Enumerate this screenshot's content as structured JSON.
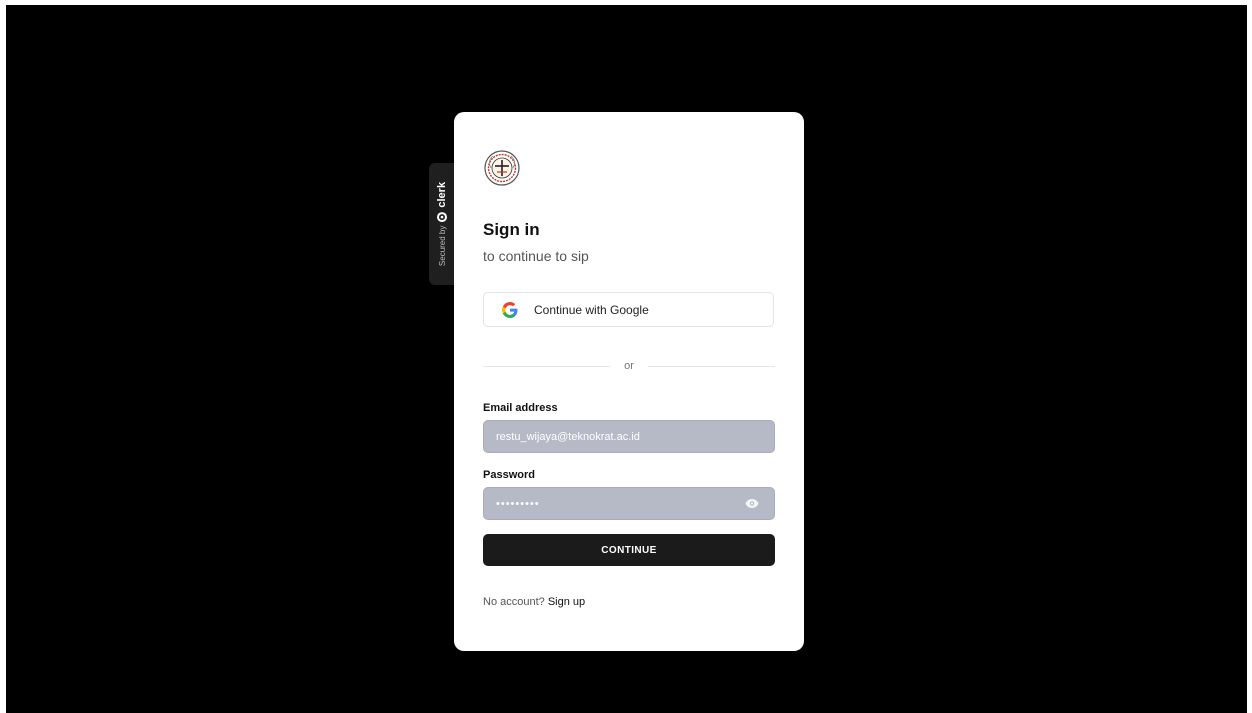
{
  "badge": {
    "secured_by": "Secured by",
    "brand": "clerk"
  },
  "card": {
    "logo_icon": "university-seal-icon",
    "title": "Sign in",
    "subtitle": "to continue to sip",
    "google_button": {
      "label": "Continue with Google",
      "icon": "google-icon"
    },
    "divider_text": "or",
    "email": {
      "label": "Email address",
      "value": "restu_wijaya@teknokrat.ac.id"
    },
    "password": {
      "label": "Password",
      "value": "•••••••••",
      "toggle_icon": "eye-icon"
    },
    "continue_label": "CONTINUE",
    "footer": {
      "prompt": "No account?",
      "link": "Sign up"
    }
  },
  "colors": {
    "background": "#000000",
    "card": "#ffffff",
    "input_fill": "#b6bac6",
    "primary_button": "#1b1b1b"
  }
}
